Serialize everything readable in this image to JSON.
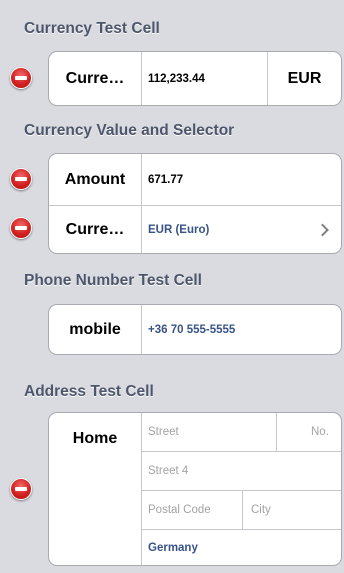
{
  "currency_test": {
    "header": "Currency Test Cell",
    "label": "Curre…",
    "value": "112,233.44",
    "code": "EUR"
  },
  "currency_value_selector": {
    "header": "Currency Value and Selector",
    "amount_label": "Amount",
    "amount_value": "671.77",
    "currency_label": "Curre…",
    "currency_value": "EUR (Euro)"
  },
  "phone_test": {
    "header": "Phone Number Test Cell",
    "label": "mobile",
    "value": "+36 70 555-5555"
  },
  "address_test": {
    "header": "Address Test Cell",
    "label": "Home",
    "street_placeholder": "Street",
    "number_placeholder": "No.",
    "street2_placeholder": "Street 4",
    "postal_code_placeholder": "Postal Code",
    "city_placeholder": "City",
    "country": "Germany"
  },
  "icons": {
    "delete": "delete-minus-icon",
    "disclosure": "chevron-right-icon"
  },
  "colors": {
    "background": "#d9dbe1",
    "header_text": "#4d566b",
    "value_blue": "#385487",
    "delete_red": "#d32222"
  }
}
